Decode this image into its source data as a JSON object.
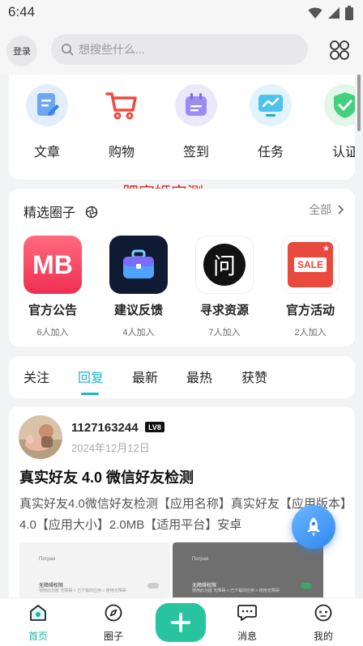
{
  "status_bar": {
    "time": "6:44"
  },
  "header": {
    "login_label": "登录",
    "search_placeholder": "想搜些什么..."
  },
  "quick_actions": [
    {
      "label": "文章",
      "icon": "article-icon"
    },
    {
      "label": "购物",
      "icon": "cart-icon"
    },
    {
      "label": "签到",
      "icon": "calendar-icon"
    },
    {
      "label": "任务",
      "icon": "monitor-icon"
    },
    {
      "label": "认证",
      "icon": "shield-check-icon"
    }
  ],
  "watermark": "肥宅姬实测",
  "circles": {
    "title": "精选圈子",
    "all_label": "全部",
    "items": [
      {
        "name": "官方公告",
        "count": "6人加入",
        "icon_text": "MB"
      },
      {
        "name": "建议反馈",
        "count": "4人加入",
        "icon_text": ""
      },
      {
        "name": "寻求资源",
        "count": "7人加入",
        "icon_text": "问"
      },
      {
        "name": "官方活动",
        "count": "2人加入",
        "icon_text": "SALE"
      }
    ]
  },
  "feed_tabs": [
    {
      "label": "关注",
      "active": false
    },
    {
      "label": "回复",
      "active": true
    },
    {
      "label": "最新",
      "active": false
    },
    {
      "label": "最热",
      "active": false
    },
    {
      "label": "获赞",
      "active": false
    }
  ],
  "post": {
    "username": "1127163244",
    "level": "LV8",
    "date": "2024年12月12日",
    "title": "真实好友 4.0 微信好友检测",
    "body": "真实好友4.0微信好友检测【应用名称】真实好友【应用版本】4.0【应用大小】2.0MB【适用平台】安卓",
    "thumb_title": "Потрая",
    "thumb_line": "无障碍权限",
    "thumb_sub": "使用此功能 无障碍 > 已下载的应用 > 使用无障碍"
  },
  "bottom_nav": [
    {
      "label": "首页",
      "active": true
    },
    {
      "label": "圈子",
      "active": false
    },
    {
      "label": "消息",
      "active": false
    },
    {
      "label": "我的",
      "active": false
    }
  ],
  "colors": {
    "accent": "#1fb5c8",
    "nav_active": "#1fb5a8",
    "add_button": "#28c4a0",
    "watermark": "#e02020"
  }
}
